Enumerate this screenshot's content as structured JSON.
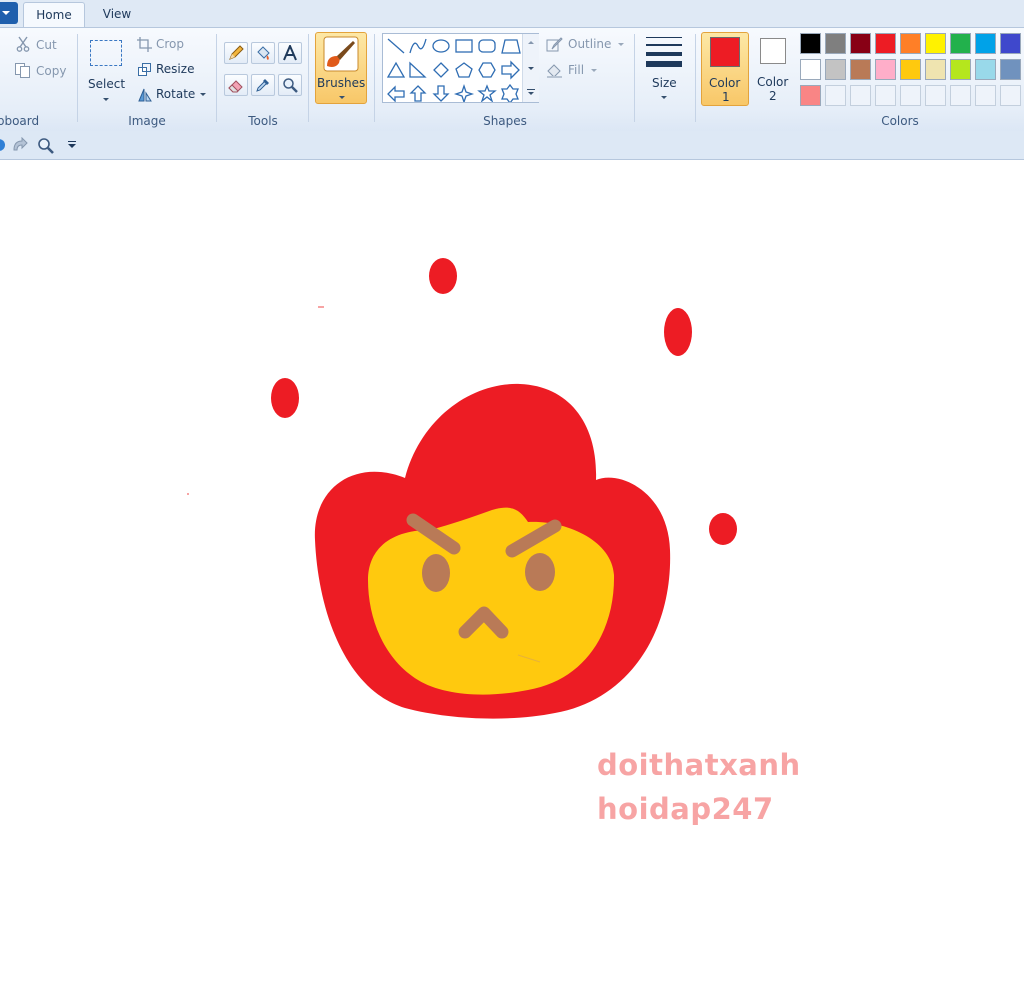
{
  "tabs": [
    {
      "label": "Home"
    },
    {
      "label": "View"
    }
  ],
  "ribbon": {
    "clipboard": {
      "group_label": "pboard",
      "cut_label": "Cut",
      "copy_label": "Copy"
    },
    "image": {
      "group_label": "Image",
      "select_label": "Select",
      "crop_label": "Crop",
      "resize_label": "Resize",
      "rotate_label": "Rotate"
    },
    "tools": {
      "group_label": "Tools"
    },
    "brushes": {
      "label": "Brushes"
    },
    "shapes": {
      "group_label": "Shapes",
      "outline_label": "Outline",
      "fill_label": "Fill"
    },
    "size": {
      "label": "Size"
    },
    "colors": {
      "group_label": "Colors",
      "color1_label": "Color",
      "color1_num": "1",
      "color2_label": "Color",
      "color2_num": "2",
      "color1_value": "#ed1c24",
      "color2_value": "#ffffff",
      "palette_row1": [
        "#000000",
        "#7f7f7f",
        "#880015",
        "#ed1c24",
        "#ff7f27",
        "#fff200",
        "#22b14c",
        "#00a2e8",
        "#3f48cc"
      ],
      "palette_row2": [
        "#ffffff",
        "#c3c3c3",
        "#b97a57",
        "#ffaec9",
        "#ffc90e",
        "#efe4b0",
        "#b5e61d",
        "#99d9ea",
        "#7092be"
      ],
      "palette_row3": [
        "#f98585",
        "",
        "",
        "",
        "",
        "",
        "",
        "",
        ""
      ]
    }
  },
  "canvas": {
    "watermark_line1": "doithatxanh",
    "watermark_line2": "hoidap247",
    "colors": {
      "flame": "#ed1c24",
      "face": "#ffc90e",
      "features": "#b97a57",
      "watermark": "#f7a4a4"
    }
  }
}
